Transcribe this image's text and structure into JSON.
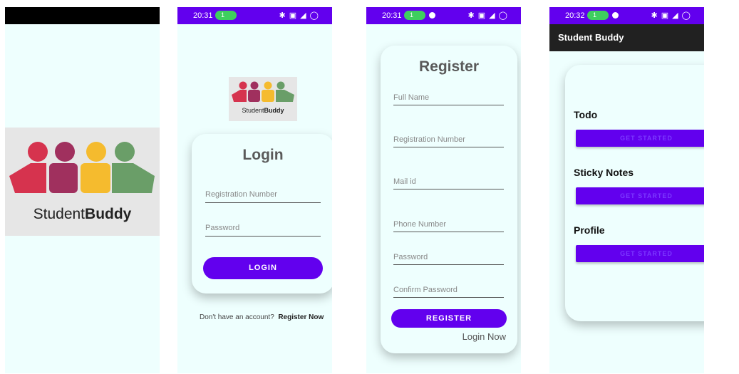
{
  "splash": {
    "logo": {
      "word_regular": "Student",
      "word_bold": "Buddy"
    }
  },
  "status_bars": [
    {
      "time": "20:31",
      "notif": "1",
      "icons": "✱ ▣ ◢ ◯"
    },
    {
      "time": "20:31",
      "notif": "1",
      "icons": "✱ ▣ ◢ ◯"
    },
    {
      "time": "20:32",
      "notif": "1",
      "icons": "✱ ▣ ◢ ◯"
    }
  ],
  "login": {
    "logo": {
      "word_regular": "Student",
      "word_bold": "Buddy"
    },
    "title": "Login",
    "registration_placeholder": "Registration Number",
    "password_placeholder": "Password",
    "login_button": "LOGIN",
    "no_account_text": "Don't have an account?",
    "register_link": "Register Now"
  },
  "register": {
    "title": "Register",
    "full_name_placeholder": "Full Name",
    "registration_placeholder": "Registration Number",
    "mail_placeholder": "Mail id",
    "phone_placeholder": "Phone Number",
    "password_placeholder": "Password",
    "confirm_password_placeholder": "Confirm Password",
    "register_button": "REGISTER",
    "login_link": "Login Now"
  },
  "home": {
    "app_title": "Student Buddy",
    "sections": [
      {
        "label": "Todo",
        "button": "GET STARTED"
      },
      {
        "label": "Sticky Notes",
        "button": "GET STARTED"
      },
      {
        "label": "Profile",
        "button": "GET STARTED"
      }
    ]
  },
  "colors": {
    "primary": "#6200ee",
    "background": "#eefffe",
    "appbar": "#212121",
    "logo_red": "#d6334e",
    "logo_maroon": "#a0305e",
    "logo_yellow": "#f5bb2e",
    "logo_green": "#6a9e68"
  }
}
